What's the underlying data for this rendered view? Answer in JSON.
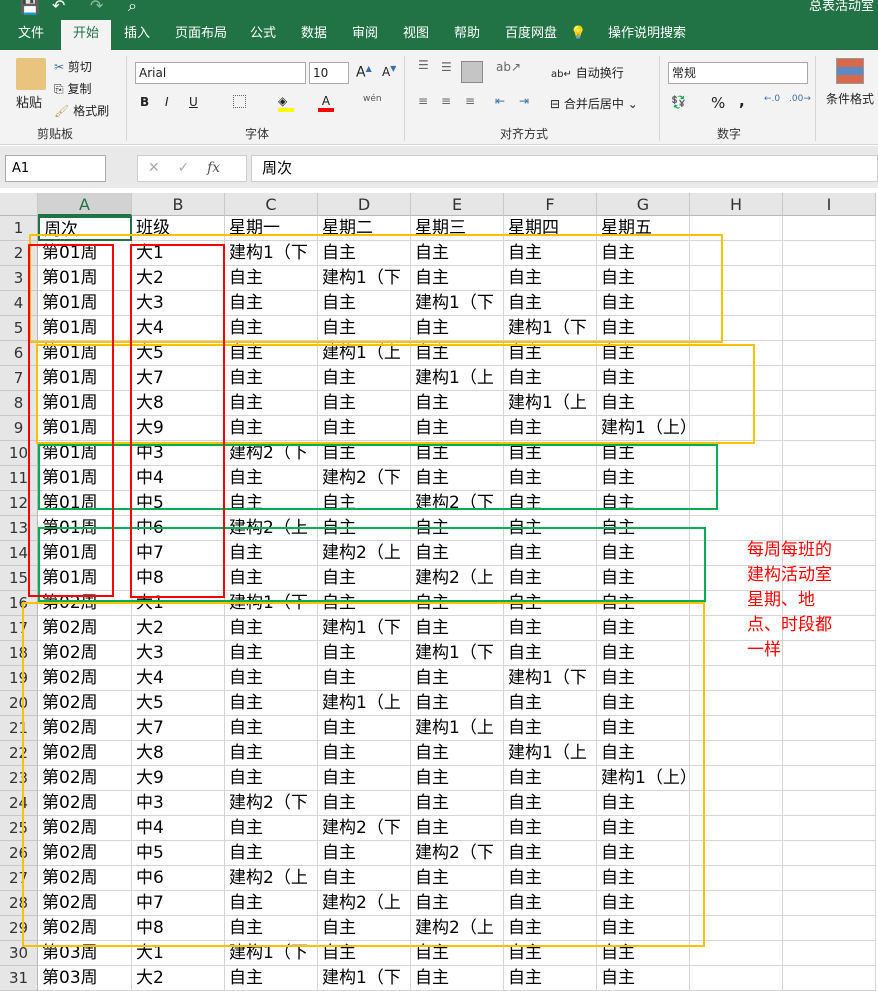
{
  "window": {
    "title": "总表活动室"
  },
  "tabs": [
    "文件",
    "开始",
    "插入",
    "页面布局",
    "公式",
    "数据",
    "审阅",
    "视图",
    "帮助",
    "百度网盘"
  ],
  "search_label": "操作说明搜索",
  "ribbon": {
    "clipboard": {
      "paste": "粘贴",
      "cut": "剪切",
      "copy": "复制",
      "format_painter": "格式刷",
      "label": "剪贴板"
    },
    "font": {
      "name": "Arial",
      "size": "10",
      "bold": "B",
      "italic": "I",
      "underline": "U",
      "label": "字体",
      "phonetic": "wén"
    },
    "alignment": {
      "wrap": "自动换行",
      "merge": "合并后居中",
      "label": "对齐方式"
    },
    "number": {
      "format": "常规",
      "percent": "%",
      "comma": ",",
      "label": "数字"
    },
    "styles": {
      "conditional": "条件格式"
    }
  },
  "formula_bar": {
    "name_box": "A1",
    "fx": "fx",
    "value": "周次"
  },
  "columns": [
    "A",
    "B",
    "C",
    "D",
    "E",
    "F",
    "G",
    "H",
    "I"
  ],
  "rows": [
    [
      "周次",
      "班级",
      "星期一",
      "星期二",
      "星期三",
      "星期四",
      "星期五"
    ],
    [
      "第01周",
      "大1",
      "建构1（下",
      "自主",
      "自主",
      "自主",
      "自主"
    ],
    [
      "第01周",
      "大2",
      "自主",
      "建构1（下",
      "自主",
      "自主",
      "自主"
    ],
    [
      "第01周",
      "大3",
      "自主",
      "自主",
      "建构1（下",
      "自主",
      "自主"
    ],
    [
      "第01周",
      "大4",
      "自主",
      "自主",
      "自主",
      "建构1（下",
      "自主"
    ],
    [
      "第01周",
      "大5",
      "自主",
      "建构1（上",
      "自主",
      "自主",
      "自主"
    ],
    [
      "第01周",
      "大7",
      "自主",
      "自主",
      "建构1（上",
      "自主",
      "自主"
    ],
    [
      "第01周",
      "大8",
      "自主",
      "自主",
      "自主",
      "建构1（上",
      "自主"
    ],
    [
      "第01周",
      "大9",
      "自主",
      "自主",
      "自主",
      "自主",
      "建构1（上）"
    ],
    [
      "第01周",
      "中3",
      "建构2（下",
      "自主",
      "自主",
      "自主",
      "自主"
    ],
    [
      "第01周",
      "中4",
      "自主",
      "建构2（下",
      "自主",
      "自主",
      "自主"
    ],
    [
      "第01周",
      "中5",
      "自主",
      "自主",
      "建构2（下",
      "自主",
      "自主"
    ],
    [
      "第01周",
      "中6",
      "建构2（上",
      "自主",
      "自主",
      "自主",
      "自主"
    ],
    [
      "第01周",
      "中7",
      "自主",
      "建构2（上",
      "自主",
      "自主",
      "自主"
    ],
    [
      "第01周",
      "中8",
      "自主",
      "自主",
      "建构2（上",
      "自主",
      "自主"
    ],
    [
      "第02周",
      "大1",
      "建构1（下",
      "自主",
      "自主",
      "自主",
      "自主"
    ],
    [
      "第02周",
      "大2",
      "自主",
      "建构1（下",
      "自主",
      "自主",
      "自主"
    ],
    [
      "第02周",
      "大3",
      "自主",
      "自主",
      "建构1（下",
      "自主",
      "自主"
    ],
    [
      "第02周",
      "大4",
      "自主",
      "自主",
      "自主",
      "建构1（下",
      "自主"
    ],
    [
      "第02周",
      "大5",
      "自主",
      "建构1（上",
      "自主",
      "自主",
      "自主"
    ],
    [
      "第02周",
      "大7",
      "自主",
      "自主",
      "建构1（上",
      "自主",
      "自主"
    ],
    [
      "第02周",
      "大8",
      "自主",
      "自主",
      "自主",
      "建构1（上",
      "自主"
    ],
    [
      "第02周",
      "大9",
      "自主",
      "自主",
      "自主",
      "自主",
      "建构1（上）"
    ],
    [
      "第02周",
      "中3",
      "建构2（下",
      "自主",
      "自主",
      "自主",
      "自主"
    ],
    [
      "第02周",
      "中4",
      "自主",
      "建构2（下",
      "自主",
      "自主",
      "自主"
    ],
    [
      "第02周",
      "中5",
      "自主",
      "自主",
      "建构2（下",
      "自主",
      "自主"
    ],
    [
      "第02周",
      "中6",
      "建构2（上",
      "自主",
      "自主",
      "自主",
      "自主"
    ],
    [
      "第02周",
      "中7",
      "自主",
      "建构2（上",
      "自主",
      "自主",
      "自主"
    ],
    [
      "第02周",
      "中8",
      "自主",
      "自主",
      "建构2（上",
      "自主",
      "自主"
    ],
    [
      "第03周",
      "大1",
      "建构1（下",
      "自主",
      "自主",
      "自主",
      "自主"
    ],
    [
      "第03周",
      "大2",
      "自主",
      "建构1（下",
      "自主",
      "自主",
      "自主"
    ]
  ],
  "annotation": {
    "lines": [
      "每周每班的",
      "建构活动室",
      "星期、地",
      "点、时段都",
      "一样"
    ],
    "color": "#ff0000"
  },
  "colors": {
    "brand": "#217346",
    "orange": "#ffc000",
    "green": "#00b050",
    "red": "#ff0000"
  }
}
